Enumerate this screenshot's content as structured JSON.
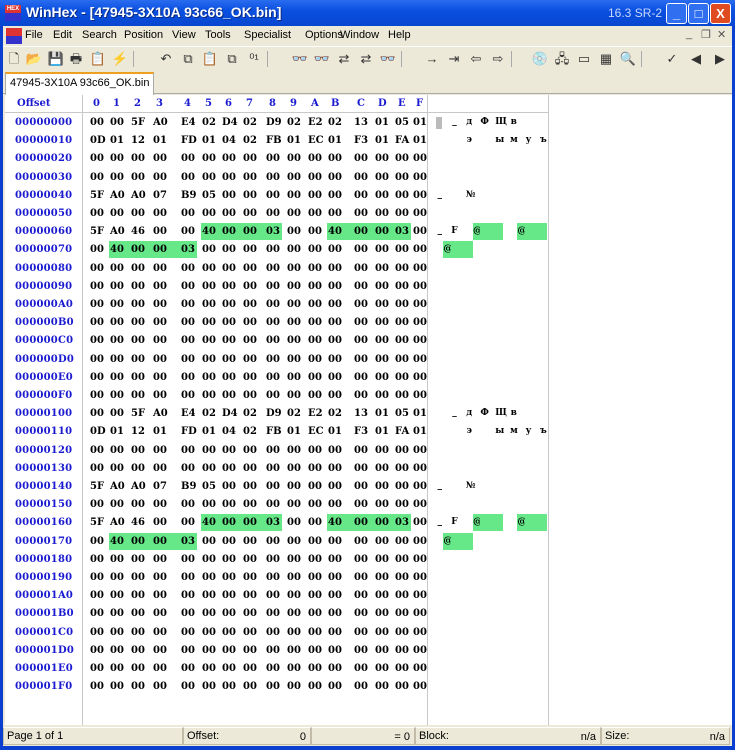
{
  "window": {
    "title": "WinHex - [47945-3X10A 93c66_OK.bin]",
    "version": "16.3 SR-2",
    "app_icon": "HEX",
    "minimize": "_",
    "maximize": "□",
    "close": "X"
  },
  "menu": [
    "File",
    "Edit",
    "Search",
    "Position",
    "View",
    "Tools",
    "Specialist",
    "Options",
    "Window",
    "Help"
  ],
  "mdi": {
    "minimize": "_",
    "restore": "❐",
    "close": "✕"
  },
  "toolbar": [
    {
      "name": "new-file-icon",
      "g": "🗋"
    },
    {
      "name": "open-icon",
      "g": "📂"
    },
    {
      "name": "save-icon",
      "g": "💾"
    },
    {
      "name": "print-icon",
      "g": "🖶"
    },
    {
      "name": "properties-icon",
      "g": "📋"
    },
    {
      "name": "run-icon",
      "g": "⚡"
    },
    {
      "name": "undo-icon",
      "g": "↶"
    },
    {
      "name": "copy-icon",
      "g": "⧉"
    },
    {
      "name": "paste-icon",
      "g": "📋"
    },
    {
      "name": "paste-write-icon",
      "g": "⧉"
    },
    {
      "name": "binary-icon",
      "g": "⁰¹"
    },
    {
      "name": "find-text-icon",
      "g": "👓"
    },
    {
      "name": "find-hex-icon",
      "g": "👓"
    },
    {
      "name": "replace-text-icon",
      "g": "⇄"
    },
    {
      "name": "replace-hex-icon",
      "g": "⇄"
    },
    {
      "name": "find-again-icon",
      "g": "👓"
    },
    {
      "name": "goto-offset-icon",
      "g": "→"
    },
    {
      "name": "goto-page-icon",
      "g": "⇥"
    },
    {
      "name": "back-icon",
      "g": "⇦"
    },
    {
      "name": "forward-icon",
      "g": "⇨"
    },
    {
      "name": "open-disk-icon",
      "g": "💿"
    },
    {
      "name": "clone-disk-icon",
      "g": "🖧"
    },
    {
      "name": "ram-icon",
      "g": "▭"
    },
    {
      "name": "calculator-icon",
      "g": "▦"
    },
    {
      "name": "analyze-icon",
      "g": "🔍"
    },
    {
      "name": "hash-icon",
      "g": "✓"
    },
    {
      "name": "prev-icon",
      "g": "◀"
    },
    {
      "name": "next-icon",
      "g": "▶"
    }
  ],
  "tab": "47945-3X10A 93c66_OK.bin",
  "header": {
    "offset": "Offset",
    "cols": [
      "0",
      "1",
      "2",
      "3",
      "4",
      "5",
      "6",
      "7",
      "8",
      "9",
      "A",
      "B",
      "C",
      "D",
      "E",
      "F"
    ]
  },
  "rows": [
    {
      "off": "00000000",
      "bytes": [
        "00",
        "00",
        "5F",
        "A0",
        "E4",
        "02",
        "D4",
        "02",
        "D9",
        "02",
        "E2",
        "02",
        "13",
        "01",
        "05",
        "01"
      ],
      "text": "  _ д Ф Щ в     "
    },
    {
      "off": "00000010",
      "bytes": [
        "0D",
        "01",
        "12",
        "01",
        "FD",
        "01",
        "04",
        "02",
        "FB",
        "01",
        "EC",
        "01",
        "F3",
        "01",
        "FA",
        "01"
      ],
      "text": "    э   ы м у ъ "
    },
    {
      "off": "00000020",
      "bytes": [
        "00",
        "00",
        "00",
        "00",
        "00",
        "00",
        "00",
        "00",
        "00",
        "00",
        "00",
        "00",
        "00",
        "00",
        "00",
        "00"
      ],
      "text": ""
    },
    {
      "off": "00000030",
      "bytes": [
        "00",
        "00",
        "00",
        "00",
        "00",
        "00",
        "00",
        "00",
        "00",
        "00",
        "00",
        "00",
        "00",
        "00",
        "00",
        "00"
      ],
      "text": ""
    },
    {
      "off": "00000040",
      "bytes": [
        "5F",
        "A0",
        "A0",
        "07",
        "B9",
        "05",
        "00",
        "00",
        "00",
        "00",
        "00",
        "00",
        "00",
        "00",
        "00",
        "00"
      ],
      "text": "_   №           "
    },
    {
      "off": "00000050",
      "bytes": [
        "00",
        "00",
        "00",
        "00",
        "00",
        "00",
        "00",
        "00",
        "00",
        "00",
        "00",
        "00",
        "00",
        "00",
        "00",
        "00"
      ],
      "text": ""
    },
    {
      "off": "00000060",
      "bytes": [
        "5F",
        "A0",
        "46",
        "00",
        "00",
        "40",
        "00",
        "00",
        "03",
        "00",
        "00",
        "40",
        "00",
        "00",
        "03",
        "00"
      ],
      "text": "_ F  @     @    ",
      "hl": [
        5,
        6,
        7,
        8,
        11,
        12,
        13,
        14
      ]
    },
    {
      "off": "00000070",
      "bytes": [
        "00",
        "40",
        "00",
        "00",
        "03",
        "00",
        "00",
        "00",
        "00",
        "00",
        "00",
        "00",
        "00",
        "00",
        "00",
        "00"
      ],
      "text": " @              ",
      "hl": [
        1,
        2,
        3,
        4
      ]
    },
    {
      "off": "00000080",
      "bytes": [
        "00",
        "00",
        "00",
        "00",
        "00",
        "00",
        "00",
        "00",
        "00",
        "00",
        "00",
        "00",
        "00",
        "00",
        "00",
        "00"
      ],
      "text": ""
    },
    {
      "off": "00000090",
      "bytes": [
        "00",
        "00",
        "00",
        "00",
        "00",
        "00",
        "00",
        "00",
        "00",
        "00",
        "00",
        "00",
        "00",
        "00",
        "00",
        "00"
      ],
      "text": ""
    },
    {
      "off": "000000A0",
      "bytes": [
        "00",
        "00",
        "00",
        "00",
        "00",
        "00",
        "00",
        "00",
        "00",
        "00",
        "00",
        "00",
        "00",
        "00",
        "00",
        "00"
      ],
      "text": ""
    },
    {
      "off": "000000B0",
      "bytes": [
        "00",
        "00",
        "00",
        "00",
        "00",
        "00",
        "00",
        "00",
        "00",
        "00",
        "00",
        "00",
        "00",
        "00",
        "00",
        "00"
      ],
      "text": ""
    },
    {
      "off": "000000C0",
      "bytes": [
        "00",
        "00",
        "00",
        "00",
        "00",
        "00",
        "00",
        "00",
        "00",
        "00",
        "00",
        "00",
        "00",
        "00",
        "00",
        "00"
      ],
      "text": ""
    },
    {
      "off": "000000D0",
      "bytes": [
        "00",
        "00",
        "00",
        "00",
        "00",
        "00",
        "00",
        "00",
        "00",
        "00",
        "00",
        "00",
        "00",
        "00",
        "00",
        "00"
      ],
      "text": ""
    },
    {
      "off": "000000E0",
      "bytes": [
        "00",
        "00",
        "00",
        "00",
        "00",
        "00",
        "00",
        "00",
        "00",
        "00",
        "00",
        "00",
        "00",
        "00",
        "00",
        "00"
      ],
      "text": ""
    },
    {
      "off": "000000F0",
      "bytes": [
        "00",
        "00",
        "00",
        "00",
        "00",
        "00",
        "00",
        "00",
        "00",
        "00",
        "00",
        "00",
        "00",
        "00",
        "00",
        "00"
      ],
      "text": ""
    },
    {
      "off": "00000100",
      "bytes": [
        "00",
        "00",
        "5F",
        "A0",
        "E4",
        "02",
        "D4",
        "02",
        "D9",
        "02",
        "E2",
        "02",
        "13",
        "01",
        "05",
        "01"
      ],
      "text": "  _ д Ф Щ в     "
    },
    {
      "off": "00000110",
      "bytes": [
        "0D",
        "01",
        "12",
        "01",
        "FD",
        "01",
        "04",
        "02",
        "FB",
        "01",
        "EC",
        "01",
        "F3",
        "01",
        "FA",
        "01"
      ],
      "text": "    э   ы м у ъ "
    },
    {
      "off": "00000120",
      "bytes": [
        "00",
        "00",
        "00",
        "00",
        "00",
        "00",
        "00",
        "00",
        "00",
        "00",
        "00",
        "00",
        "00",
        "00",
        "00",
        "00"
      ],
      "text": ""
    },
    {
      "off": "00000130",
      "bytes": [
        "00",
        "00",
        "00",
        "00",
        "00",
        "00",
        "00",
        "00",
        "00",
        "00",
        "00",
        "00",
        "00",
        "00",
        "00",
        "00"
      ],
      "text": ""
    },
    {
      "off": "00000140",
      "bytes": [
        "5F",
        "A0",
        "A0",
        "07",
        "B9",
        "05",
        "00",
        "00",
        "00",
        "00",
        "00",
        "00",
        "00",
        "00",
        "00",
        "00"
      ],
      "text": "_   №           "
    },
    {
      "off": "00000150",
      "bytes": [
        "00",
        "00",
        "00",
        "00",
        "00",
        "00",
        "00",
        "00",
        "00",
        "00",
        "00",
        "00",
        "00",
        "00",
        "00",
        "00"
      ],
      "text": ""
    },
    {
      "off": "00000160",
      "bytes": [
        "5F",
        "A0",
        "46",
        "00",
        "00",
        "40",
        "00",
        "00",
        "03",
        "00",
        "00",
        "40",
        "00",
        "00",
        "03",
        "00"
      ],
      "text": "_ F  @     @    ",
      "hl": [
        5,
        6,
        7,
        8,
        11,
        12,
        13,
        14
      ]
    },
    {
      "off": "00000170",
      "bytes": [
        "00",
        "40",
        "00",
        "00",
        "03",
        "00",
        "00",
        "00",
        "00",
        "00",
        "00",
        "00",
        "00",
        "00",
        "00",
        "00"
      ],
      "text": " @              ",
      "hl": [
        1,
        2,
        3,
        4
      ]
    },
    {
      "off": "00000180",
      "bytes": [
        "00",
        "00",
        "00",
        "00",
        "00",
        "00",
        "00",
        "00",
        "00",
        "00",
        "00",
        "00",
        "00",
        "00",
        "00",
        "00"
      ],
      "text": ""
    },
    {
      "off": "00000190",
      "bytes": [
        "00",
        "00",
        "00",
        "00",
        "00",
        "00",
        "00",
        "00",
        "00",
        "00",
        "00",
        "00",
        "00",
        "00",
        "00",
        "00"
      ],
      "text": ""
    },
    {
      "off": "000001A0",
      "bytes": [
        "00",
        "00",
        "00",
        "00",
        "00",
        "00",
        "00",
        "00",
        "00",
        "00",
        "00",
        "00",
        "00",
        "00",
        "00",
        "00"
      ],
      "text": ""
    },
    {
      "off": "000001B0",
      "bytes": [
        "00",
        "00",
        "00",
        "00",
        "00",
        "00",
        "00",
        "00",
        "00",
        "00",
        "00",
        "00",
        "00",
        "00",
        "00",
        "00"
      ],
      "text": ""
    },
    {
      "off": "000001C0",
      "bytes": [
        "00",
        "00",
        "00",
        "00",
        "00",
        "00",
        "00",
        "00",
        "00",
        "00",
        "00",
        "00",
        "00",
        "00",
        "00",
        "00"
      ],
      "text": ""
    },
    {
      "off": "000001D0",
      "bytes": [
        "00",
        "00",
        "00",
        "00",
        "00",
        "00",
        "00",
        "00",
        "00",
        "00",
        "00",
        "00",
        "00",
        "00",
        "00",
        "00"
      ],
      "text": ""
    },
    {
      "off": "000001E0",
      "bytes": [
        "00",
        "00",
        "00",
        "00",
        "00",
        "00",
        "00",
        "00",
        "00",
        "00",
        "00",
        "00",
        "00",
        "00",
        "00",
        "00"
      ],
      "text": ""
    },
    {
      "off": "000001F0",
      "bytes": [
        "00",
        "00",
        "00",
        "00",
        "00",
        "00",
        "00",
        "00",
        "00",
        "00",
        "00",
        "00",
        "00",
        "00",
        "00",
        "00"
      ],
      "text": ""
    }
  ],
  "status": {
    "page": "Page 1 of 1",
    "offset_label": "Offset:",
    "offset_value": "0",
    "equals": "= 0",
    "block_label": "Block:",
    "block_value": "n/a",
    "size_label": "Size:",
    "size_value": "n/a"
  },
  "colors": {
    "highlight": "#66e888",
    "offset_blue": "#1a1ad0"
  }
}
